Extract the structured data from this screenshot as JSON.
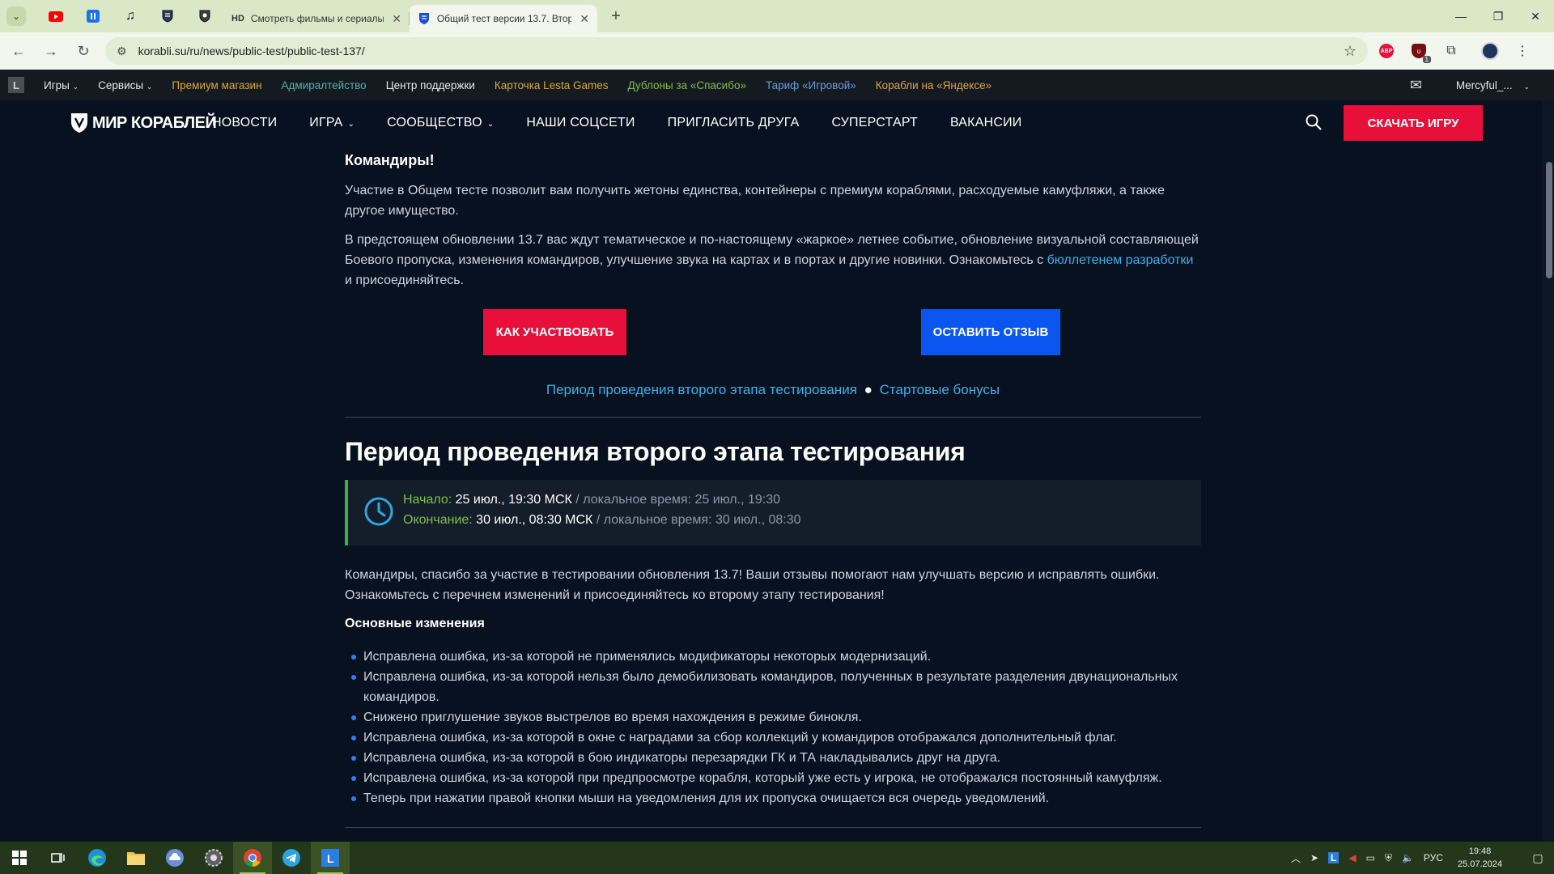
{
  "browser": {
    "tabs": [
      {
        "label": "",
        "icon": "youtube-icon"
      },
      {
        "label": "",
        "icon": "pause-icon"
      },
      {
        "label": "",
        "icon": "music-note-icon"
      },
      {
        "label": "",
        "icon": "shield-icon"
      },
      {
        "label": "",
        "icon": "shield-icon"
      },
      {
        "label": "Смотреть фильмы и сериалы о",
        "icon": "hd-icon",
        "favicon_text": "HD"
      },
      {
        "label": "Общий тест версии 13.7. Втор",
        "icon": "shield-icon",
        "active": true
      }
    ],
    "url": "korabli.su/ru/news/public-test/public-test-137/",
    "abp_label": "ABP",
    "ublock_count": "1"
  },
  "lesta_bar": {
    "logo": "L",
    "items": [
      {
        "label": "Игры",
        "color": "white",
        "dropdown": true
      },
      {
        "label": "Сервисы",
        "color": "white",
        "dropdown": true
      },
      {
        "label": "Премиум магазин",
        "color": "yellow"
      },
      {
        "label": "Адмиралтейство",
        "color": "teal"
      },
      {
        "label": "Центр поддержки",
        "color": "white"
      },
      {
        "label": "Карточка Lesta Games",
        "color": "yellow"
      },
      {
        "label": "Дублоны за «Спасибо»",
        "color": "green"
      },
      {
        "label": "Тариф «Игровой»",
        "color": "blue"
      },
      {
        "label": "Корабли на «Яндексе»",
        "color": "orange"
      }
    ],
    "user": "Mercyful_..."
  },
  "site_header": {
    "brand": "МИР КОРАБЛЕЙ",
    "nav": [
      {
        "label": "НОВОСТИ",
        "dropdown": false
      },
      {
        "label": "ИГРА",
        "dropdown": true
      },
      {
        "label": "СООБЩЕСТВО",
        "dropdown": true
      },
      {
        "label": "НАШИ СОЦСЕТИ",
        "dropdown": false
      },
      {
        "label": "ПРИГЛАСИТЬ ДРУГА",
        "dropdown": false
      },
      {
        "label": "СУПЕРСТАРТ",
        "dropdown": false
      },
      {
        "label": "ВАКАНСИИ",
        "dropdown": false
      }
    ],
    "download_label": "СКАЧАТЬ ИГРУ"
  },
  "article": {
    "greeting": "Командиры!",
    "intro": "Участие в Общем тесте позволит вам получить жетоны единства, контейнеры с премиум кораблями, расходуемые камуфляжи, а также другое имущество.",
    "update_text_before": "В предстоящем обновлении 13.7 вас ждут тематическое и по-настоящему «жаркое» летнее событие, обновление визуальной составляющей Боевого пропуска, изменения командиров, улучшение звука на картах и в портах и другие новинки. Ознакомьтесь с",
    "update_link": "бюллетенем разработки",
    "update_text_after": "и присоединяйтесь.",
    "btn_participate": "КАК УЧАСТВОВАТЬ",
    "btn_review": "ОСТАВИТЬ ОТЗЫВ",
    "anchor1": "Период проведения второго этапа тестирования",
    "anchor_sep": "●",
    "anchor2": "Стартовые бонусы",
    "section_title": "Период проведения второго этапа тестирования",
    "period": {
      "start_label": "Начало:",
      "start_value": "25 июл., 19:30 МСК",
      "start_local": "/ локальное время: 25 июл., 19:30",
      "end_label": "Окончание:",
      "end_value": "30 июл., 08:30 МСК",
      "end_local": "/ локальное время: 30 июл., 08:30"
    },
    "thanks": "Командиры, спасибо за участие в тестировании обновления 13.7! Ваши отзывы помогают нам улучшать версию и исправлять ошибки. Ознакомьтесь с перечнем изменений и присоединяйтесь ко второму этапу тестирования!",
    "changes_title": "Основные изменения",
    "changes": [
      "Исправлена ошибка, из-за которой не применялись модификаторы некоторых модернизаций.",
      "Исправлена ошибка, из-за которой нельзя было демобилизовать командиров, полученных в результате разделения двунациональных командиров.",
      "Снижено приглушение звуков выстрелов во время нахождения в режиме бинокля.",
      "Исправлена ошибка, из-за которой в окне с наградами за сбор коллекций у командиров отображался дополнительный флаг.",
      "Исправлена ошибка, из-за которой в бою индикаторы перезарядки ГК и ТА накладывались друг на друга.",
      "Исправлена ошибка, из-за которой при предпросмотре корабля, который уже есть у игрока, не отображался постоянный камуфляж.",
      "Теперь при нажатии правой кнопки мыши на уведомления для их пропуска очищается вся очередь уведомлений."
    ]
  },
  "taskbar": {
    "apps": [
      "windows-start-icon",
      "task-view-icon",
      "edge-icon",
      "file-explorer-icon",
      "cloud-app-icon",
      "settings-gear-icon",
      "chrome-icon",
      "telegram-icon",
      "lesta-icon"
    ],
    "lang": "РУС",
    "time": "19:48",
    "date": "25.07.2024"
  },
  "colors": {
    "accent_red": "#e8103a",
    "accent_blue": "#0b56f0",
    "link": "#3bb1ec",
    "bg": "#07111f"
  }
}
